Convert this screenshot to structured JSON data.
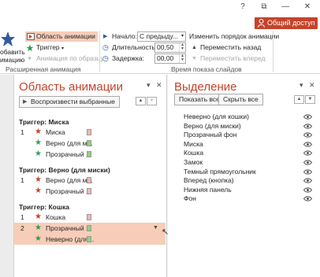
{
  "window": {
    "help": "?",
    "restore": "⧉",
    "minimize": "—",
    "close": "✕"
  },
  "share_button": {
    "label": "Общий доступ"
  },
  "ribbon": {
    "add_animation": {
      "line1": "обавить",
      "line2": "имацию"
    },
    "animation_pane_btn": "Область анимации",
    "trigger_btn": "Триггер",
    "painter_btn": "Анимация по образцу",
    "advanced_group": "Расширенная анимация",
    "start_label": "Начало:",
    "start_value": "С предыду...",
    "duration_label": "Длительность:",
    "duration_value": "00,50",
    "delay_label": "Задержка:",
    "delay_value": "00,00",
    "timing_group": "Время показа слайдов",
    "reorder_label": "Изменить порядок анимации",
    "move_back": "Переместить назад",
    "move_forward": "Переместить вперед",
    "colors": {
      "accent": "#c5432b",
      "highlight": "#f7cdb9"
    }
  },
  "animation_pane": {
    "title": "Область анимации",
    "play_button": "Воспроизвести выбранные",
    "groups": [
      {
        "trigger": "Триггер: Миска",
        "rows": [
          {
            "num": "1",
            "star": "red",
            "label": "Миска",
            "bar": "red"
          },
          {
            "num": "",
            "star": "green",
            "label": "Верно (для м...",
            "bar": "green"
          },
          {
            "num": "",
            "star": "green",
            "label": "Прозрачный ...",
            "bar": "green"
          }
        ]
      },
      {
        "trigger": "Триггер: Верно (для миски)",
        "rows": [
          {
            "num": "1",
            "star": "red",
            "label": "Верно (для м...",
            "bar": "red"
          },
          {
            "num": "",
            "star": "red",
            "label": "Прозрачный ...",
            "bar": "red"
          }
        ]
      },
      {
        "trigger": "Триггер: Кошка",
        "rows": [
          {
            "num": "1",
            "star": "red",
            "label": "Кошка",
            "bar": "red"
          },
          {
            "num": "2",
            "star": "green",
            "label": "Прозрачный ...",
            "bar": "green",
            "selected": true
          },
          {
            "num": "",
            "star": "green",
            "label": "Неверно (для...",
            "bar": "green",
            "selected": true
          }
        ]
      }
    ]
  },
  "selection_pane": {
    "title": "Выделение",
    "show_all": "Показать все",
    "hide_all": "Скрыть все",
    "items": [
      "Неверно (для кошки)",
      "Верно (для миски)",
      "Прозрачный фон",
      "Миска",
      "Кошка",
      "Замок",
      "Темный прямоугольник",
      "Вперед (кнопка)",
      "Нижняя панель",
      "Фон"
    ]
  }
}
